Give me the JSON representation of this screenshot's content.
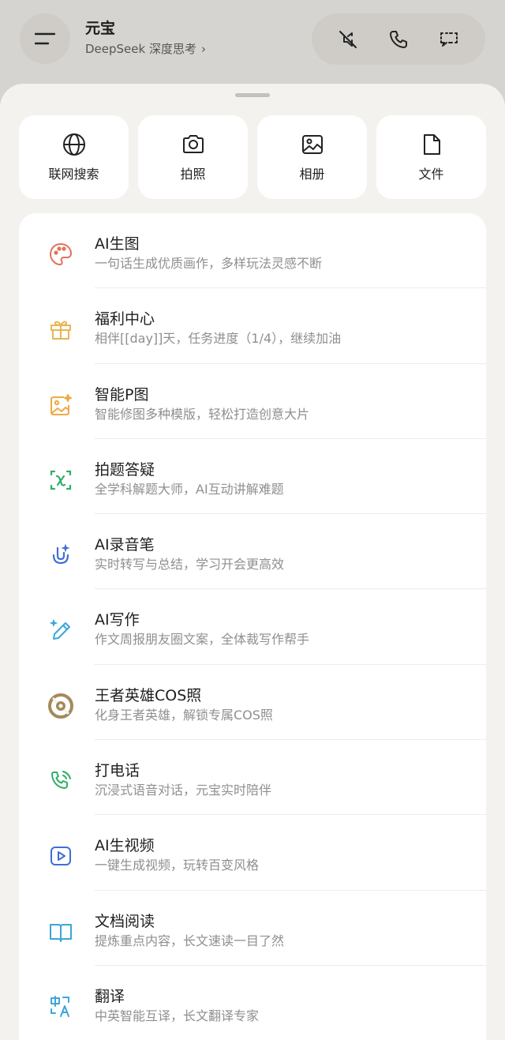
{
  "header": {
    "title": "元宝",
    "subtitle": "DeepSeek 深度思考",
    "subtitle_chevron": "›"
  },
  "header_actions": [
    {
      "icon": "mute-icon"
    },
    {
      "icon": "phone-icon"
    },
    {
      "icon": "screen-share-icon"
    }
  ],
  "quick_actions": [
    {
      "label": "联网搜索",
      "icon": "globe-icon"
    },
    {
      "label": "拍照",
      "icon": "camera-icon"
    },
    {
      "label": "相册",
      "icon": "image-icon"
    },
    {
      "label": "文件",
      "icon": "file-icon"
    }
  ],
  "features": [
    {
      "title": "AI生图",
      "desc": "一句话生成优质画作，多样玩法灵感不断",
      "icon": "palette-icon",
      "color": "#e2725b"
    },
    {
      "title": "福利中心",
      "desc": "相伴[[day]]天，任务进度（1/4），继续加油",
      "icon": "gift-icon",
      "color": "#e9b552"
    },
    {
      "title": "智能P图",
      "desc": "智能修图多种模版，轻松打造创意大片",
      "icon": "image-sparkle-icon",
      "color": "#efa946"
    },
    {
      "title": "拍题答疑",
      "desc": "全学科解题大师，AI互动讲解难题",
      "icon": "formula-scan-icon",
      "color": "#2fae6b"
    },
    {
      "title": "AI录音笔",
      "desc": "实时转写与总结，学习开会更高效",
      "icon": "recorder-icon",
      "color": "#3f6fd1"
    },
    {
      "title": "AI写作",
      "desc": "作文周报朋友圈文案，全体裁写作帮手",
      "icon": "pen-icon",
      "color": "#3ba6d9"
    },
    {
      "title": "王者英雄COS照",
      "desc": "化身王者英雄，解锁专属COS照",
      "icon": "hero-emblem-icon",
      "color": "#a48a5c"
    },
    {
      "title": "打电话",
      "desc": "沉浸式语音对话，元宝实时陪伴",
      "icon": "phone-call-icon",
      "color": "#2fae6b"
    },
    {
      "title": "AI生视频",
      "desc": "一键生成视频，玩转百变风格",
      "icon": "video-play-icon",
      "color": "#3f6fd1"
    },
    {
      "title": "文档阅读",
      "desc": "提炼重点内容，长文速读一目了然",
      "icon": "book-icon",
      "color": "#3ba6d9"
    },
    {
      "title": "翻译",
      "desc": "中英智能互译，长文翻译专家",
      "icon": "translate-icon",
      "color": "#3ba6d9"
    }
  ]
}
